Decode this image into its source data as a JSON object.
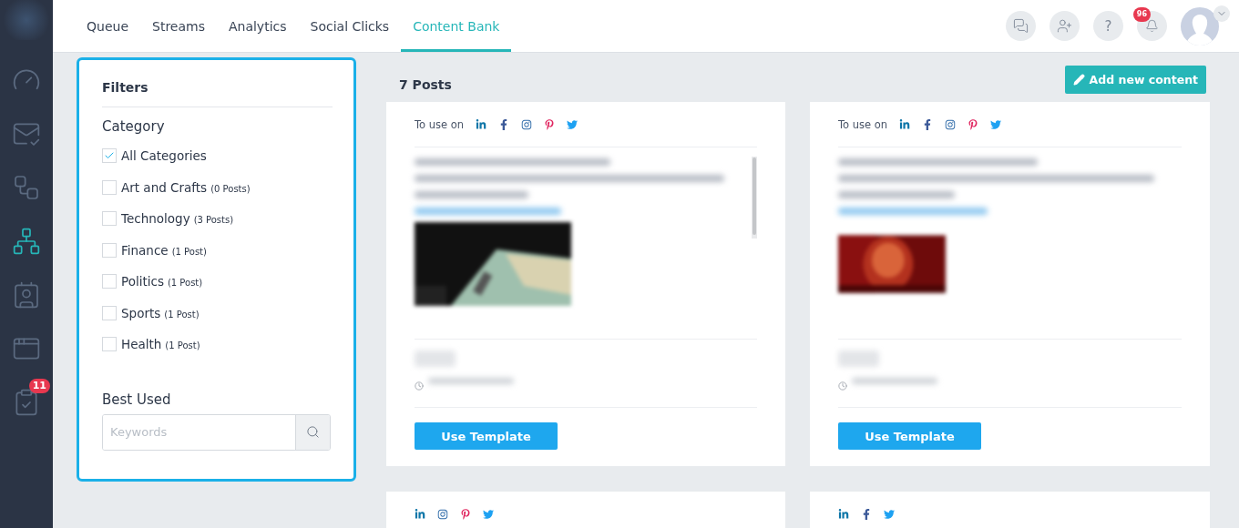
{
  "sidebar": {
    "items": [
      {
        "kind": "gauge",
        "selected": false
      },
      {
        "kind": "mail",
        "selected": false
      },
      {
        "kind": "workflow",
        "selected": false
      },
      {
        "kind": "network",
        "selected": true
      },
      {
        "kind": "contact",
        "selected": false
      },
      {
        "kind": "browser",
        "selected": false
      },
      {
        "kind": "clipboard",
        "selected": false,
        "badge": "11"
      }
    ]
  },
  "tabs": [
    {
      "label": "Queue",
      "selected": false
    },
    {
      "label": "Streams",
      "selected": false
    },
    {
      "label": "Analytics",
      "selected": false
    },
    {
      "label": "Social Clicks",
      "selected": false
    },
    {
      "label": "Content Bank",
      "selected": true
    }
  ],
  "header_actions": [
    {
      "kind": "chat"
    },
    {
      "kind": "user"
    },
    {
      "kind": "help",
      "label": "?"
    },
    {
      "kind": "bell",
      "badge": "96"
    }
  ],
  "filters": {
    "title": "Filters",
    "category_title": "Category",
    "categories": [
      {
        "label": "All Categories",
        "checked": true
      },
      {
        "label": "Art and Crafts",
        "count": "(0 Posts)",
        "checked": false
      },
      {
        "label": "Technology",
        "count": "(3 Posts)",
        "checked": false
      },
      {
        "label": "Finance",
        "count": "(1 Post)",
        "checked": false
      },
      {
        "label": "Politics",
        "count": "(1 Post)",
        "checked": false
      },
      {
        "label": "Sports",
        "count": "(1 Post)",
        "checked": false
      },
      {
        "label": "Health",
        "count": "(1 Post)",
        "checked": false
      }
    ],
    "best_used_title": "Best Used",
    "search": {
      "placeholder": "Keywords"
    }
  },
  "posts": {
    "count": "7 Posts",
    "add_button": "Add new content",
    "cards": [
      {
        "label": "To use on",
        "button": "Use Template"
      },
      {
        "label": "To use on",
        "button": "Use Template"
      },
      {
        "kind": "partial"
      },
      {
        "kind": "partial"
      }
    ]
  }
}
